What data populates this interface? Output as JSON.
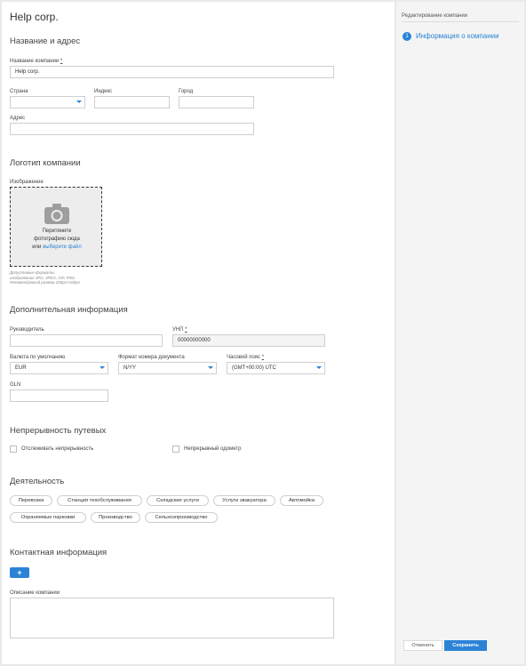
{
  "company": {
    "title": "Help corp."
  },
  "sections": {
    "name_address": "Название и адрес",
    "logo": "Логотип компании",
    "additional": "Дополнительная информация",
    "continuity": "Непрерывность путевых",
    "activity": "Деятельность",
    "contacts": "Контактная информация"
  },
  "fields": {
    "company_name": {
      "label": "Название компании",
      "required_mark": "*",
      "value": "Help corp."
    },
    "country": {
      "label": "Страна",
      "value": ""
    },
    "index": {
      "label": "Индекс",
      "value": ""
    },
    "city": {
      "label": "Город",
      "value": ""
    },
    "address": {
      "label": "Адрес",
      "value": ""
    },
    "image": {
      "label": "Изображение"
    },
    "director": {
      "label": "Руководитель",
      "value": ""
    },
    "unp": {
      "label": "УНП",
      "required_mark": "*",
      "value": "00000000000"
    },
    "currency": {
      "label": "Валюта по умолчанию",
      "value": "EUR"
    },
    "doc_format": {
      "label": "Формат номера документа",
      "value": "N/YY"
    },
    "timezone": {
      "label": "Часовой пояс",
      "required_mark": "*",
      "value": "(GMT+00:00) UTC"
    },
    "gln": {
      "label": "GLN",
      "value": ""
    },
    "description": {
      "label": "Описание компании",
      "value": ""
    }
  },
  "dropzone": {
    "line1": "Перетяните",
    "line2": "фотографию сюда",
    "or_text": "или ",
    "link_text": "выберите файл",
    "hint1": "Допустимые форматы",
    "hint2": "изображения JPG, JPEG, GIF, PNG",
    "hint3": "Рекомендуемый размер 200px×100px"
  },
  "checkboxes": {
    "track_continuity": {
      "label": "Отслеживать непрерывность",
      "checked": false
    },
    "continuous_odometer": {
      "label": "Непрерывный одометр",
      "checked": false
    }
  },
  "activities": [
    "Перевозка",
    "Станция техобслуживания",
    "Складские услуги",
    "Услуги эвакуатора",
    "Автомойка",
    "Охраняемые парковки",
    "Производство",
    "Сельхозпроизводство"
  ],
  "contacts": {
    "add_button": "+"
  },
  "sidebar": {
    "header": "Редактирование компании",
    "steps": [
      {
        "number": "1",
        "label": "Информация о компании"
      }
    ]
  },
  "actions": {
    "cancel": "Отменить",
    "save": "Сохранить"
  },
  "colors": {
    "accent": "#2b83d6",
    "page_bg": "#e9e9e9",
    "border": "#cfcfcf"
  },
  "icons": {
    "dropzone": "camera-icon",
    "dropdown": "chevron-down-icon"
  }
}
